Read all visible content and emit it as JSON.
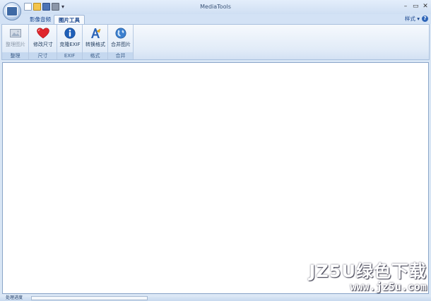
{
  "window": {
    "title": "MediaTools",
    "controls": [
      "–",
      "▭",
      "✕"
    ]
  },
  "quick_access": {
    "more": "▾"
  },
  "tabs": [
    {
      "label": "影像音频"
    },
    {
      "label": "图片工具",
      "active": true
    }
  ],
  "style_menu": {
    "label": "样式 ▾",
    "help": "?"
  },
  "ribbon": {
    "groups": [
      {
        "label": "整理",
        "buttons": [
          {
            "label": "整理图片",
            "icon": "picture-icon",
            "disabled": true
          }
        ]
      },
      {
        "label": "尺寸",
        "buttons": [
          {
            "label": "修改尺寸",
            "icon": "heart-icon"
          }
        ]
      },
      {
        "label": "EXIF",
        "buttons": [
          {
            "label": "克隆EXIF",
            "icon": "info-icon"
          }
        ]
      },
      {
        "label": "格式",
        "buttons": [
          {
            "label": "转换格式",
            "icon": "convert-icon"
          }
        ]
      },
      {
        "label": "合并",
        "buttons": [
          {
            "label": "合并图片",
            "icon": "globe-icon"
          }
        ]
      }
    ]
  },
  "status": {
    "text": "处理进度",
    "progress": 0.0
  },
  "watermark": {
    "line1": "JZ5U绿色下载",
    "line2": "www.jz5u.com"
  },
  "colors": {
    "accent": "#15428b",
    "ribbon_border": "#a9c0de",
    "heart": "#e0262c",
    "info": "#1f5fb8"
  }
}
